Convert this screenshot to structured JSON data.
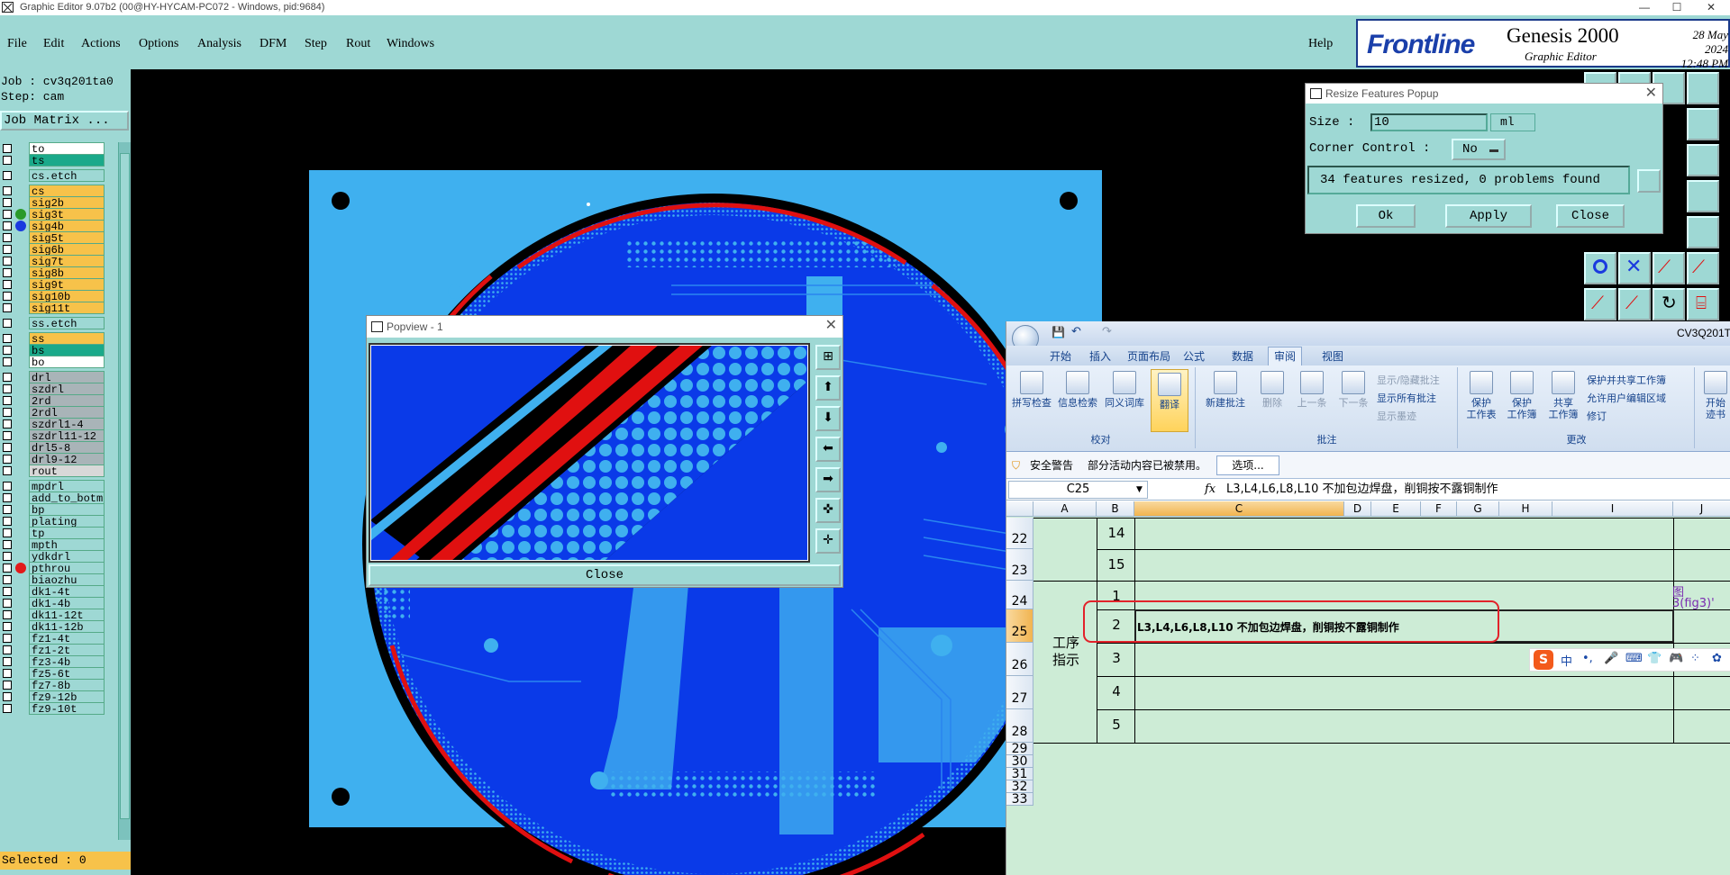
{
  "window": {
    "title": "Graphic Editor 9.07b2 (00@HY-HYCAM-PC072 - Windows, pid:9684)"
  },
  "menu": {
    "items": [
      "File",
      "Edit",
      "Actions",
      "Options",
      "Analysis",
      "DFM",
      "Step",
      "Rout",
      "Windows"
    ],
    "help": "Help"
  },
  "brand": {
    "logo_prefix": "Front",
    "logo_suffix": "line",
    "product": "Genesis 2000",
    "subtitle": "Graphic Editor",
    "date": "28 May 2024",
    "time": "12:48 PM"
  },
  "job": {
    "job_line": "Job : cv3q201ta0",
    "step_line": "Step: cam",
    "job_matrix_label": "Job Matrix ...",
    "selected_label": "Selected : 0"
  },
  "layers": [
    {
      "name": "to",
      "color": "#ffffff"
    },
    {
      "name": "ts",
      "color": "#1aa98a"
    },
    {
      "name": "cs.etch",
      "color": "#9ed8d4"
    },
    {
      "name": "cs",
      "color": "#f7c24a"
    },
    {
      "name": "sig2b",
      "color": "#f7c24a"
    },
    {
      "name": "sig3t",
      "color": "#f7c24a",
      "dot": "#2a9a2a"
    },
    {
      "name": "sig4b",
      "color": "#f7c24a",
      "dot": "#1a3adf"
    },
    {
      "name": "sig5t",
      "color": "#f7c24a"
    },
    {
      "name": "sig6b",
      "color": "#f7c24a"
    },
    {
      "name": "sig7t",
      "color": "#f7c24a"
    },
    {
      "name": "sig8b",
      "color": "#f7c24a"
    },
    {
      "name": "sig9t",
      "color": "#f7c24a"
    },
    {
      "name": "sig10b",
      "color": "#f7c24a"
    },
    {
      "name": "sig11t",
      "color": "#f7c24a"
    },
    {
      "name": "ss.etch",
      "color": "#9ed8d4"
    },
    {
      "name": "ss",
      "color": "#f7c24a"
    },
    {
      "name": "bs",
      "color": "#1aa98a"
    },
    {
      "name": "bo",
      "color": "#ffffff"
    },
    {
      "name": "drl",
      "color": "#a9b4b8"
    },
    {
      "name": "szdrl",
      "color": "#a9b4b8"
    },
    {
      "name": "2rd",
      "color": "#a9b4b8"
    },
    {
      "name": "2rdl",
      "color": "#a9b4b8"
    },
    {
      "name": "szdrl1-4",
      "color": "#a9b4b8"
    },
    {
      "name": "szdrl11-12",
      "color": "#a9b4b8"
    },
    {
      "name": "drl5-8",
      "color": "#a9b4b8"
    },
    {
      "name": "drl9-12",
      "color": "#a9b4b8"
    },
    {
      "name": "rout",
      "color": "#d8d8d8"
    },
    {
      "name": "mpdrl",
      "color": "#9ed8d4"
    },
    {
      "name": "add_to_botm",
      "color": "#9ed8d4"
    },
    {
      "name": "bp",
      "color": "#9ed8d4"
    },
    {
      "name": "plating",
      "color": "#9ed8d4"
    },
    {
      "name": "tp",
      "color": "#9ed8d4"
    },
    {
      "name": "mpth",
      "color": "#9ed8d4"
    },
    {
      "name": "ydkdrl",
      "color": "#9ed8d4"
    },
    {
      "name": "pthrou",
      "color": "#9ed8d4",
      "dot": "#e21a1a"
    },
    {
      "name": "biaozhu",
      "color": "#9ed8d4"
    },
    {
      "name": "dk1-4t",
      "color": "#9ed8d4"
    },
    {
      "name": "dk1-4b",
      "color": "#9ed8d4"
    },
    {
      "name": "dk11-12t",
      "color": "#9ed8d4"
    },
    {
      "name": "dk11-12b",
      "color": "#9ed8d4"
    },
    {
      "name": "fz1-4t",
      "color": "#9ed8d4"
    },
    {
      "name": "fz1-2t",
      "color": "#9ed8d4"
    },
    {
      "name": "fz3-4b",
      "color": "#9ed8d4"
    },
    {
      "name": "fz5-6t",
      "color": "#9ed8d4"
    },
    {
      "name": "fz7-8b",
      "color": "#9ed8d4"
    },
    {
      "name": "fz9-12b",
      "color": "#9ed8d4"
    },
    {
      "name": "fz9-10t",
      "color": "#9ed8d4"
    }
  ],
  "popview": {
    "title": "Popview - 1",
    "close_label": "Close"
  },
  "resize_popup": {
    "title": "Resize Features Popup",
    "size_label": "Size :",
    "size_value": "10",
    "unit": "ml",
    "corner_label": "Corner Control :",
    "corner_value": "No",
    "message": "34 features resized, 0 problems found",
    "ok_label": "Ok",
    "apply_label": "Apply",
    "close_label": "Close"
  },
  "excel": {
    "title": "CV3Q201T",
    "tabs": [
      "开始",
      "插入",
      "页面布局",
      "公式",
      "数据",
      "审阅",
      "视图"
    ],
    "active_tab": "审阅",
    "ribbon": {
      "proofing": {
        "label": "校对",
        "buttons": [
          "拼写检查",
          "信息检索",
          "同义词库",
          "翻译"
        ]
      },
      "comments": {
        "label": "批注",
        "buttons": [
          "新建批注",
          "删除",
          "上一条",
          "下一条"
        ],
        "small": [
          "显示/隐藏批注",
          "显示所有批注",
          "显示墨迹"
        ]
      },
      "changes": {
        "label": "更改",
        "buttons": [
          "保护\n工作表",
          "保护\n工作簿",
          "共享\n工作簿"
        ],
        "small": [
          "保护并共享工作簿",
          "允许用户编辑区域",
          "修订"
        ]
      },
      "extra": [
        "开始\n迹书"
      ]
    },
    "security_warning": "安全警告",
    "security_text": "部分活动内容已被禁用。",
    "security_button": "选项...",
    "name_box": "C25",
    "fx": "fx",
    "formula": "L3,L4,L6,L8,L10 不加包边焊盘，削铜按不露铜制作",
    "columns": [
      "A",
      "B",
      "C",
      "D",
      "E",
      "F",
      "G",
      "H",
      "I",
      "J"
    ],
    "rows": [
      {
        "num": "22",
        "b": "14"
      },
      {
        "num": "23",
        "b": "15"
      },
      {
        "num": "24",
        "b": "1"
      },
      {
        "num": "25",
        "b": "2"
      },
      {
        "num": "26",
        "b": "3"
      },
      {
        "num": "27",
        "b": "4"
      },
      {
        "num": "28",
        "b": "5"
      },
      {
        "num": "29",
        "b": ""
      },
      {
        "num": "30",
        "b": ""
      },
      {
        "num": "31",
        "b": ""
      },
      {
        "num": "32",
        "b": ""
      },
      {
        "num": "33",
        "b": ""
      }
    ],
    "merged_a": "工序\n指示",
    "c25_text": "L3,L4,L6,L8,L10 不加包边焊盘，削铜按不露铜制作",
    "j24_line1": "图",
    "j24_line2": "3(fig3)'",
    "ime": [
      "中",
      "•,",
      "🎤",
      "⌨",
      "👕",
      "🎮",
      "⁘",
      "✿"
    ]
  },
  "colors": {
    "panel": "#9ed8d4",
    "board_bg": "#3fb0ef",
    "copper": "#0a3ae8",
    "trace": "#2a86ef",
    "red": "#e01010"
  }
}
